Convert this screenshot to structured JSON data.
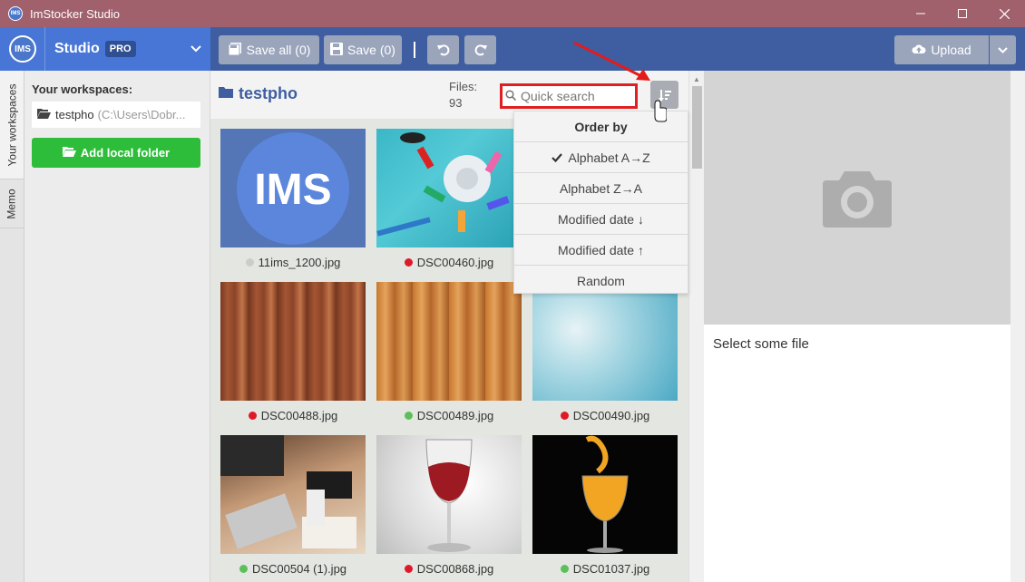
{
  "window": {
    "title": "ImStocker Studio",
    "app_icon_text": "IMS",
    "controls": [
      "minimize",
      "maximize",
      "close"
    ]
  },
  "toolbar": {
    "logo_text": "IMS",
    "brand": "Studio",
    "badge": "PRO",
    "save_all_label": "Save all (0)",
    "save_label": "Save (0)",
    "upload_label": "Upload"
  },
  "side_tabs": {
    "workspaces": "Your workspaces",
    "memo": "Memo"
  },
  "workspaces": {
    "header": "Your workspaces:",
    "items": [
      {
        "name": "testpho",
        "path": "(C:\\Users\\Dobr..."
      }
    ],
    "add_button": "Add local folder"
  },
  "main": {
    "folder": "testpho",
    "files_label": "Files:",
    "files_count": "93",
    "search_placeholder": "Quick search"
  },
  "sort_menu": {
    "header": "Order by",
    "items": [
      {
        "label": "Alphabet A→Z",
        "checked": true
      },
      {
        "label": "Alphabet Z→A",
        "checked": false
      },
      {
        "label": "Modified date ↓",
        "checked": false
      },
      {
        "label": "Modified date ↑",
        "checked": false
      },
      {
        "label": "Random",
        "checked": false
      }
    ]
  },
  "files": [
    {
      "name": "11ims_1200.jpg",
      "status": "#cccccc"
    },
    {
      "name": "DSC00460.jpg",
      "status": "#e0192a"
    },
    {
      "name": "DSC00488.jpg",
      "status": "#e0192a"
    },
    {
      "name": "DSC00489.jpg",
      "status": "#5cbf5a"
    },
    {
      "name": "DSC00490.jpg",
      "status": "#e0192a"
    },
    {
      "name": "DSC00504 (1).jpg",
      "status": "#5cbf5a"
    },
    {
      "name": "DSC00868.jpg",
      "status": "#e0192a"
    },
    {
      "name": "DSC01037.jpg",
      "status": "#5cbf5a"
    }
  ],
  "preview": {
    "empty_text": "Select some file"
  },
  "colors": {
    "titlebar": "#a0606c",
    "toolbar": "#3e5ea1",
    "brand": "#4876d6",
    "accent_green": "#2ebd3a",
    "highlight_red": "#e02020"
  }
}
